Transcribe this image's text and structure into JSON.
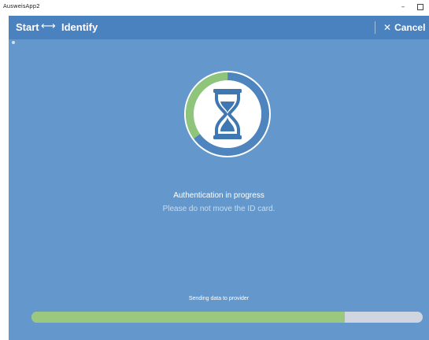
{
  "window": {
    "title": "AusweisApp2",
    "minimize_glyph": "–",
    "maximize_icon": "maximize-icon"
  },
  "navbar": {
    "start_label": "Start",
    "arrow_glyph": "⟷",
    "current_label": "Identify",
    "cancel_label": "Cancel",
    "cancel_glyph": "✕"
  },
  "status": {
    "icon": "hourglass-icon",
    "title": "Authentication in progress",
    "subtitle": "Please do not move the ID card."
  },
  "progress": {
    "label": "Sending data to provider",
    "fraction": 0.8
  },
  "ring": {
    "progress_fraction": 0.35
  },
  "colors": {
    "navbar": "#4a82bf",
    "background": "#6498cc",
    "ring_track": "#4f85bf",
    "ring_progress": "#8fc57a",
    "progress_fill": "#9bc87f",
    "progress_track": "#cfd6e0"
  }
}
